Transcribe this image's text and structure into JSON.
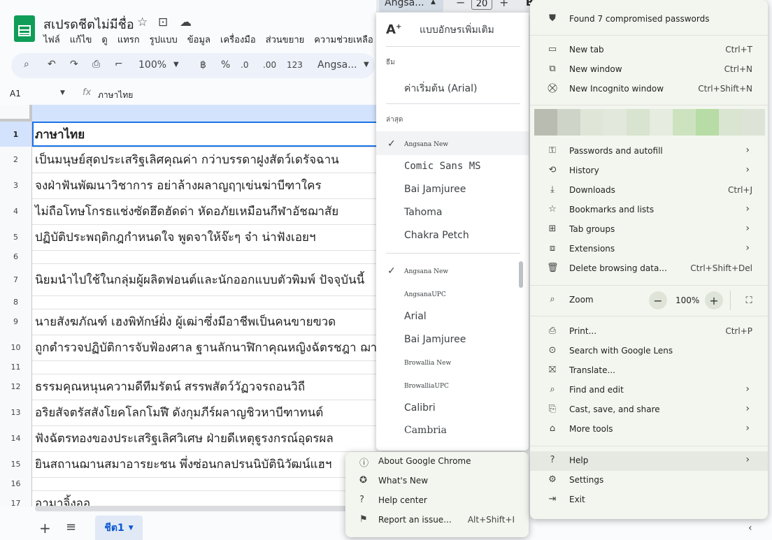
{
  "sheet": {
    "title": "สเปรดชีตไม่มีชื่อ",
    "menu": [
      "ไฟล์",
      "แก้ไข",
      "ดู",
      "แทรก",
      "รูปแบบ",
      "ข้อมูล",
      "เครื่องมือ",
      "ส่วนขยาย",
      "ความช่วยเหลือ"
    ],
    "toolbar": {
      "zoom": "100%",
      "currency": "฿",
      "percent": "%",
      "dec_dec": ".0",
      "inc_dec": ".00",
      "number_fmt": "123",
      "font": "Angsa..."
    },
    "name_box": "A1",
    "formula_value": "ภาษาไทย",
    "rows": [
      {
        "num": "1",
        "text": "ภาษาไทย"
      },
      {
        "num": "2",
        "text": "เป็นมนุษย์สุดประเสริฐเลิศคุณค่า กว่าบรรดาฝูงสัตว์เดรัจฉาน"
      },
      {
        "num": "3",
        "text": "จงฝ่าฟันพัฒนาวิชาการ  อย่าล้างผลาญฤๅเข่นฆ่าบีฑาใคร"
      },
      {
        "num": "4",
        "text": "ไม่ถือโทษโกรธแช่งซัดฮึดฮัดด่า หัดอภัยเหมือนกีฬาอัชฌาสัย"
      },
      {
        "num": "5",
        "text": "ปฏิบัติประพฤติกฎกำหนดใจ พูดจาให้จ๊ะๆ จ๋า น่าฟังเอยฯ"
      },
      {
        "num": "6",
        "text": ""
      },
      {
        "num": "7",
        "text": "นิยมนำไปใช้ในกลุ่มผู้ผลิตฟอนต์และนักออกแบบตัวพิมพ์ ปัจจุบันนี้"
      },
      {
        "num": "8",
        "text": ""
      },
      {
        "num": "9",
        "text": "นายสังฆภัณฑ์ เฮงพิทักษ์ฝั่ง ผู้เฒ่าซึ่งมีอาชีพเป็นคนขายฃวด"
      },
      {
        "num": "10",
        "text": "ถูกตำรวจปฏิบัติการจับฟ้องศาล ฐานลักนาฬิกาคุณหญิงฉัตรชฎา ฌาน"
      },
      {
        "num": "11",
        "text": ""
      },
      {
        "num": "12",
        "text": "ธรรมคุณหนุนความดีทีมรัตน์ สรรพสัตว์วัฏวจรถอนวิถี"
      },
      {
        "num": "13",
        "text": "อริยสัจตรัสสังโยคโลกโมฬี ดังกุมภีร์ผลาญชิวหาบีฑาทนต์"
      },
      {
        "num": "14",
        "text": "ฟังฉัตรทองของประเสริฐเลิศวิเศษ ฝ่ายดีเหตุฐูรงกรณ์อุดรผล"
      },
      {
        "num": "15",
        "text": "ยินสถานฌานสมาอารยะชน พึ่งซ่อนกลปรนนิบัตินิวัฒน์แฮฯ"
      },
      {
        "num": "16",
        "text": ""
      },
      {
        "num": "17",
        "text": "อามาจิ้งออ"
      }
    ],
    "sheet_tab": "ชีต1"
  },
  "font_bar": {
    "font": "Angsa...",
    "size": "20",
    "bold": "B"
  },
  "font_menu": {
    "more_fonts": "แบบอักษรเพิ่มเติม",
    "theme_label": "ธีม",
    "theme_default": "ค่าเริ่มต้น (Arial)",
    "recent_label": "ล่าสุด",
    "recent": [
      "Angsana New",
      "Comic Sans MS",
      "Bai Jamjuree",
      "Tahoma",
      "Chakra Petch"
    ],
    "all": [
      "Angsana New",
      "AngsanaUPC",
      "Arial",
      "Bai Jamjuree",
      "Browallia New",
      "BrowalliaUPC",
      "Calibri",
      "Cambria"
    ]
  },
  "chrome_menu": {
    "security_notice": "Found 7 compromised passwords",
    "items": [
      {
        "label": "New tab",
        "shortcut": "Ctrl+T"
      },
      {
        "label": "New window",
        "shortcut": "Ctrl+N"
      },
      {
        "label": "New Incognito window",
        "shortcut": "Ctrl+Shift+N"
      },
      {
        "label": "Passwords and autofill",
        "shortcut": ""
      },
      {
        "label": "History",
        "shortcut": ""
      },
      {
        "label": "Downloads",
        "shortcut": "Ctrl+J"
      },
      {
        "label": "Bookmarks and lists",
        "shortcut": ""
      },
      {
        "label": "Tab groups",
        "shortcut": ""
      },
      {
        "label": "Extensions",
        "shortcut": ""
      },
      {
        "label": "Delete browsing data...",
        "shortcut": "Ctrl+Shift+Del"
      },
      {
        "label": "Zoom",
        "shortcut": ""
      },
      {
        "label": "Print...",
        "shortcut": "Ctrl+P"
      },
      {
        "label": "Search with Google Lens",
        "shortcut": ""
      },
      {
        "label": "Translate...",
        "shortcut": ""
      },
      {
        "label": "Find and edit",
        "shortcut": ""
      },
      {
        "label": "Cast, save, and share",
        "shortcut": ""
      },
      {
        "label": "More tools",
        "shortcut": ""
      },
      {
        "label": "Help",
        "shortcut": ""
      },
      {
        "label": "Settings",
        "shortcut": ""
      },
      {
        "label": "Exit",
        "shortcut": ""
      }
    ],
    "zoom_value": "100%",
    "profile_colors": [
      "#b9bcb1",
      "#cfd4c8",
      "#dfe6d8",
      "#e2e8db",
      "#d8e3d0",
      "#e6ecdf",
      "#cde3c0",
      "#b7dca5",
      "#d9e5d1",
      "#dde3d6"
    ]
  },
  "help_menu": {
    "items": [
      {
        "label": "About Google Chrome",
        "shortcut": ""
      },
      {
        "label": "What's New",
        "shortcut": ""
      },
      {
        "label": "Help center",
        "shortcut": ""
      },
      {
        "label": "Report an issue...",
        "shortcut": "Alt+Shift+I"
      }
    ]
  }
}
